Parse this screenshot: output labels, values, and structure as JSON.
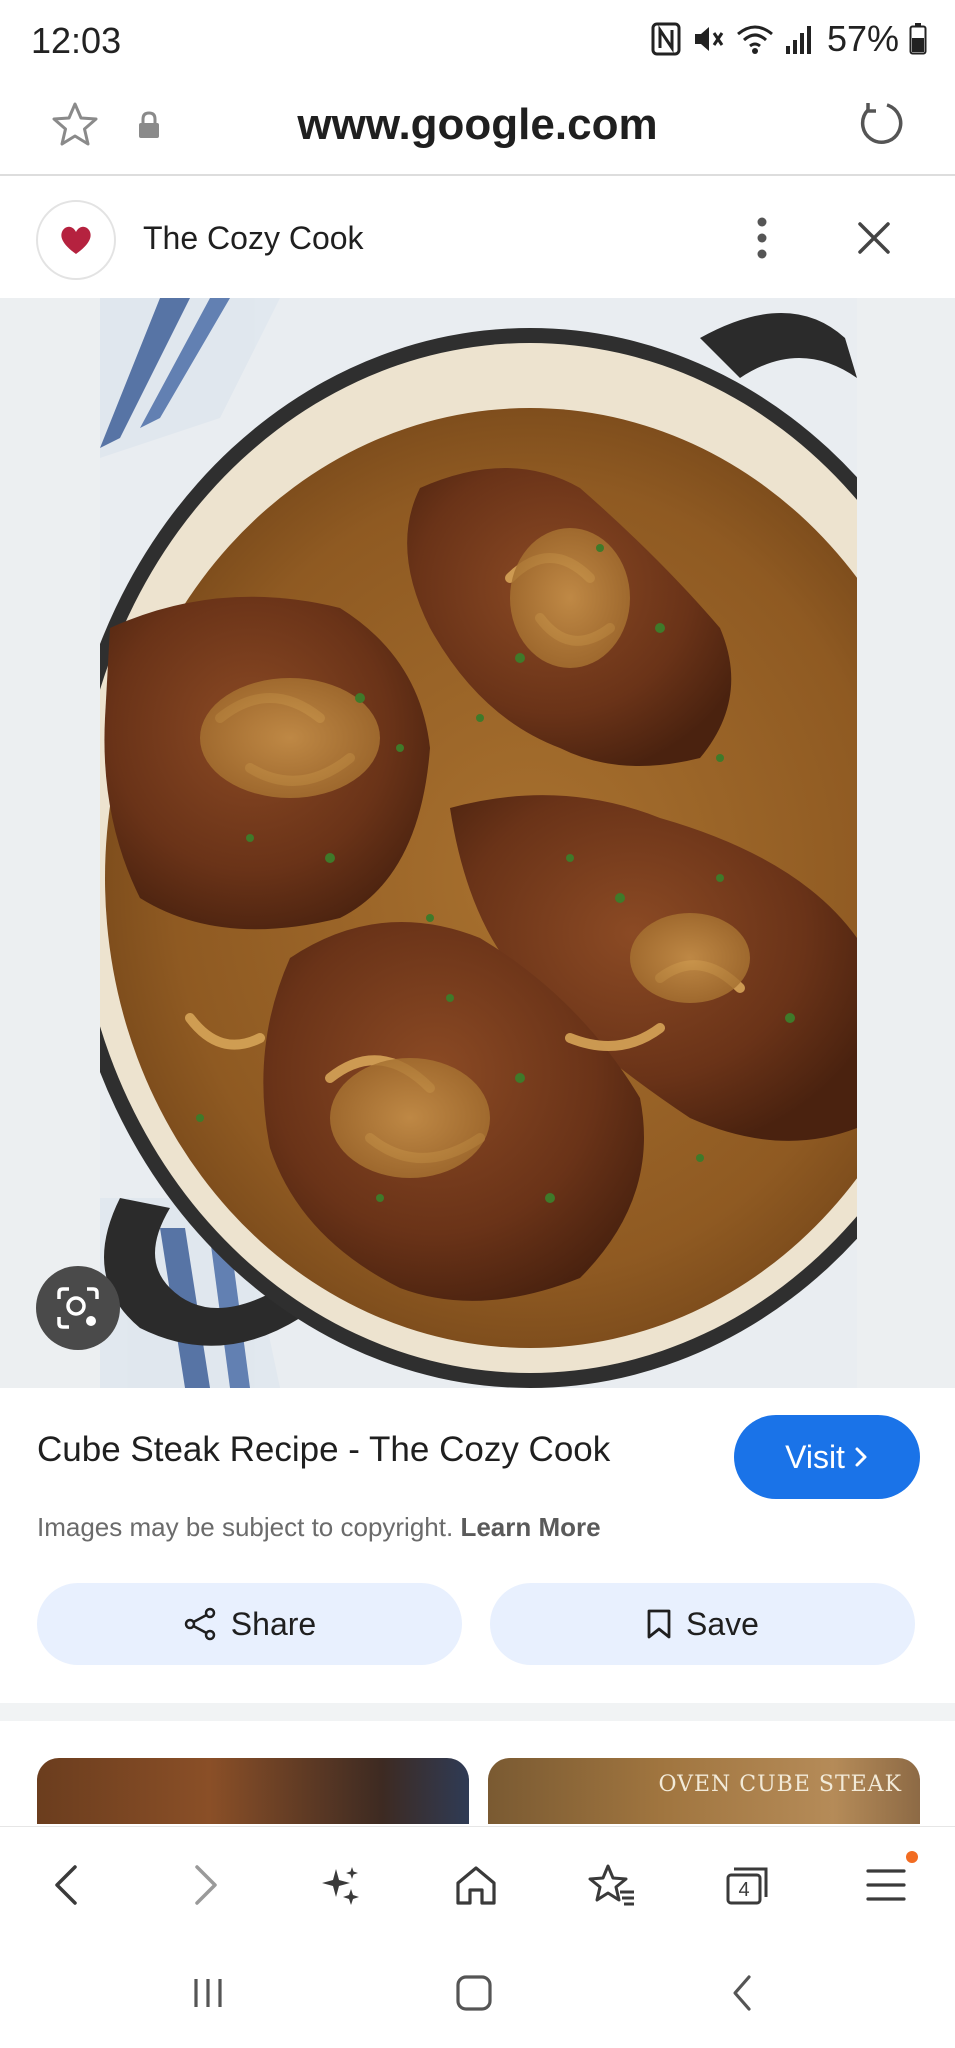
{
  "status_bar": {
    "time": "12:03",
    "battery_percent": "57%",
    "icons": [
      "nfc-icon",
      "mute-icon",
      "wifi-icon",
      "signal-icon",
      "battery-icon"
    ]
  },
  "url_bar": {
    "url": "www.google.com",
    "icons": [
      "star-icon",
      "lock-icon",
      "refresh-icon"
    ]
  },
  "source": {
    "name": "The Cozy Cook",
    "favicon": "heart-icon"
  },
  "result": {
    "title": "Cube Steak Recipe - The Cozy Cook",
    "visit_label": "Visit",
    "copyright_text": "Images may be subject to copyright.",
    "learn_more_label": "Learn More",
    "share_label": "Share",
    "save_label": "Save"
  },
  "related": {
    "thumb2_caption": "OVEN CUBE STEAK"
  },
  "bottom_nav": {
    "tab_count": "4",
    "items": [
      "back-icon",
      "forward-icon",
      "sparkle-icon",
      "home-icon",
      "bookmarks-icon",
      "tabs-icon",
      "menu-icon"
    ]
  },
  "colors": {
    "visit_button": "#1a73e8",
    "action_button_bg": "#e8f0fe",
    "notification_dot": "#f26c22",
    "favicon_heart": "#b5223f"
  }
}
